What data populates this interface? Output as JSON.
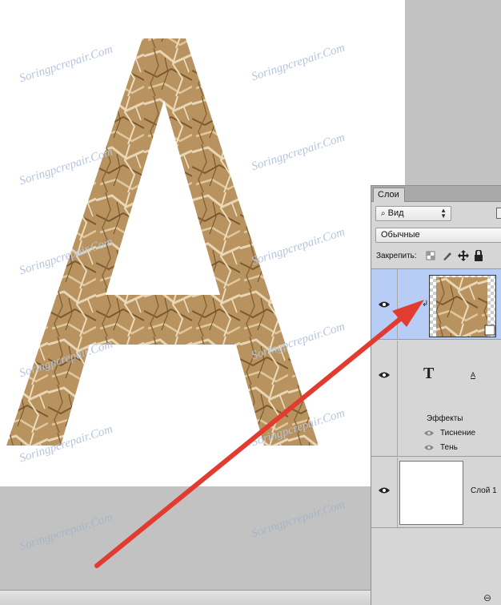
{
  "watermark": "Soringpcrepair.Com",
  "layers_panel": {
    "tab_label": "Слои",
    "filter_label": "Вид",
    "blend_mode": "Обычные",
    "lock_label": "Закрепить:",
    "layers": [
      {
        "name": "",
        "type": "texture",
        "selected": true
      },
      {
        "name": "",
        "type": "text",
        "effects_label": "Эффекты",
        "effects": [
          "Тиснение",
          "Тень"
        ]
      },
      {
        "name": "Слой 1",
        "type": "fill"
      }
    ]
  },
  "annotation": {
    "arrow_color": "#e23b2f"
  }
}
